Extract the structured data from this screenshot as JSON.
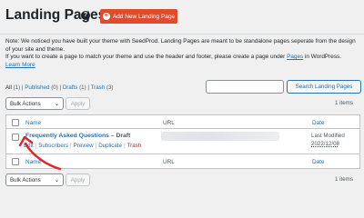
{
  "header": {
    "title": "Landing Pages",
    "help_symbol": "?",
    "add_button_label": "Add New Landing Page",
    "add_button_symbol": "+"
  },
  "notice": {
    "line1": "Note: We noticed you have built your theme with SeedProd. Landing Pages are meant to be standalone pages seperate from the design of your site and theme.",
    "line2_before": "If you want to create a page to match your theme and use the header and footer, please create a page under ",
    "line2_link": "Pages",
    "line2_after": " in WordPress.",
    "learn_more": "Learn More"
  },
  "views": {
    "all": "All",
    "all_count": "(1)",
    "published": "Published",
    "published_count": "(0)",
    "drafts": "Drafts",
    "drafts_count": "(1)",
    "trash": "Trash",
    "trash_count": "(3)",
    "separator": "|"
  },
  "search": {
    "placeholder": "",
    "button_label": "Search Landing Pages"
  },
  "bulk_top": {
    "select_label": "Bulk Actions",
    "apply_label": "Apply",
    "items_count": "1 items"
  },
  "bulk_bottom": {
    "select_label": "Bulk Actions",
    "apply_label": "Apply",
    "items_count": "1 items"
  },
  "table": {
    "columns": {
      "name": "Name",
      "url": "URL",
      "date": "Date"
    },
    "rows": [
      {
        "title": "Frequently Asked Questions",
        "state": "– Draft",
        "actions": [
          "Edit",
          "Subscribers",
          "Preview",
          "Duplicate",
          "Trash"
        ],
        "date_label": "Last Modified",
        "date_value": "2022/12/08"
      }
    ]
  },
  "colors": {
    "accent": "#e04a2d",
    "link": "#2271b1",
    "trash": "#b32d2e",
    "annotation_arrow": "#e8202a"
  },
  "icons": {
    "help": "question-circle-icon",
    "add": "plus-circle-icon",
    "dropdown": "chevron-down-icon",
    "annotation": "curved-arrow-icon"
  }
}
